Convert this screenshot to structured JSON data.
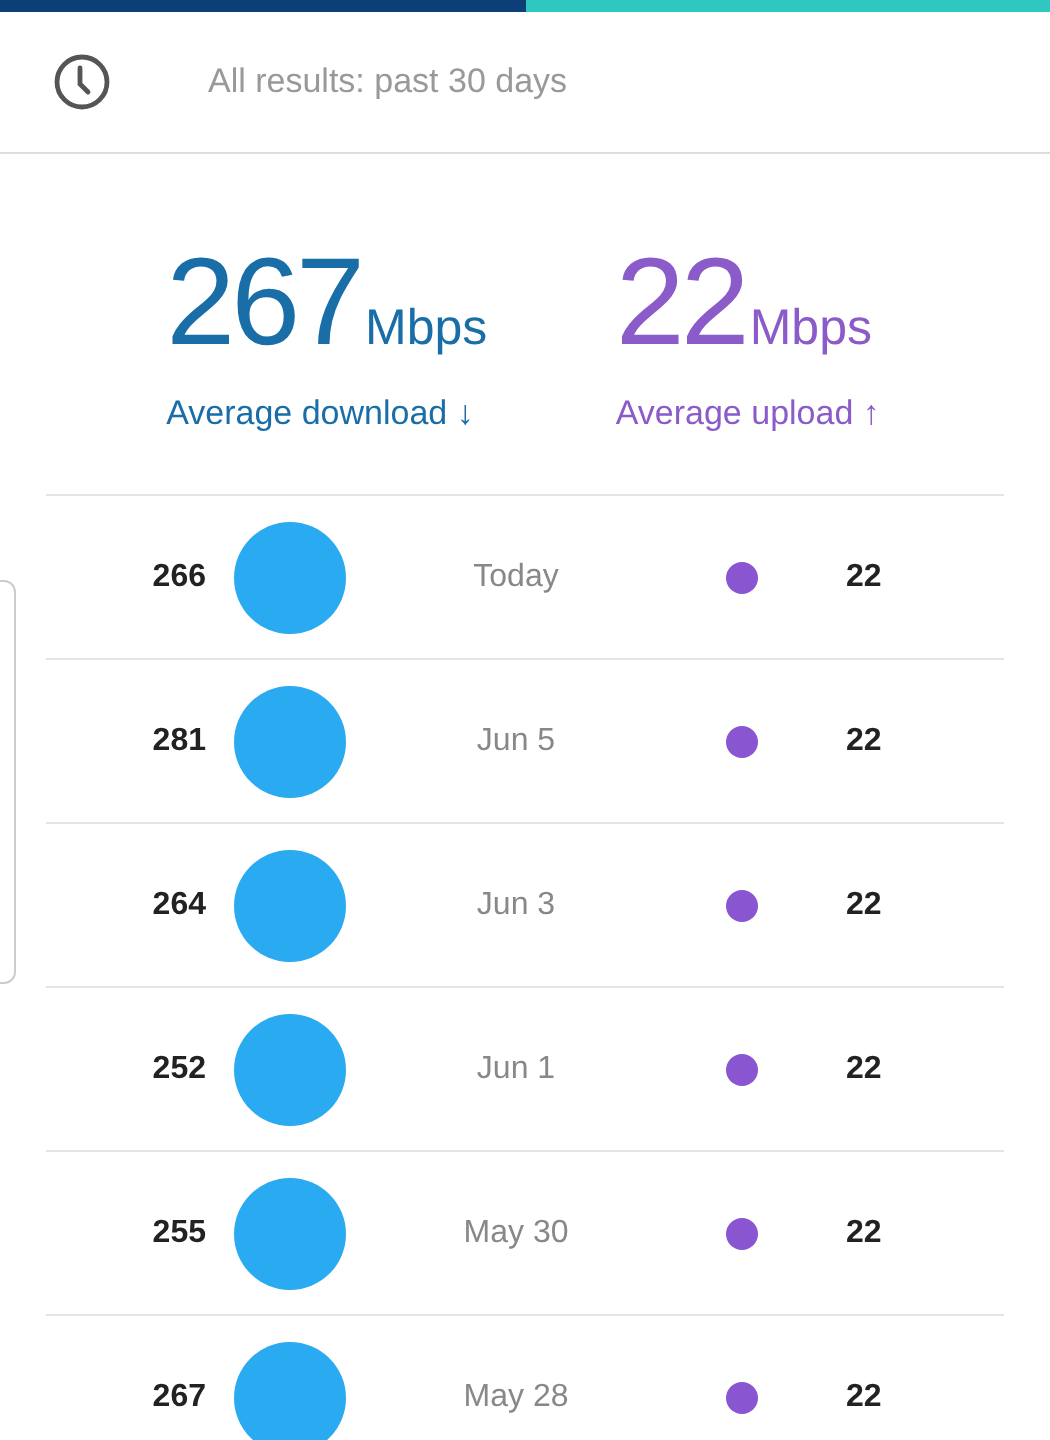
{
  "progress": {
    "level": 0.5
  },
  "filter": {
    "label": "All results: past 30 days"
  },
  "summary": [
    {
      "kind": "download",
      "value": "267",
      "unit": "Mbps",
      "label": "Average download ↓"
    },
    {
      "kind": "upload",
      "value": "22",
      "unit": "Mbps",
      "label": "Average upload ↑"
    }
  ],
  "results": [
    {
      "download": "266",
      "date": "Today",
      "upload": "22"
    },
    {
      "download": "281",
      "date": "Jun 5",
      "upload": "22"
    },
    {
      "download": "264",
      "date": "Jun 3",
      "upload": "22"
    },
    {
      "download": "252",
      "date": "Jun 1",
      "upload": "22"
    },
    {
      "download": "255",
      "date": "May 30",
      "upload": "22"
    },
    {
      "download": "267",
      "date": "May 28",
      "upload": "22"
    }
  ]
}
